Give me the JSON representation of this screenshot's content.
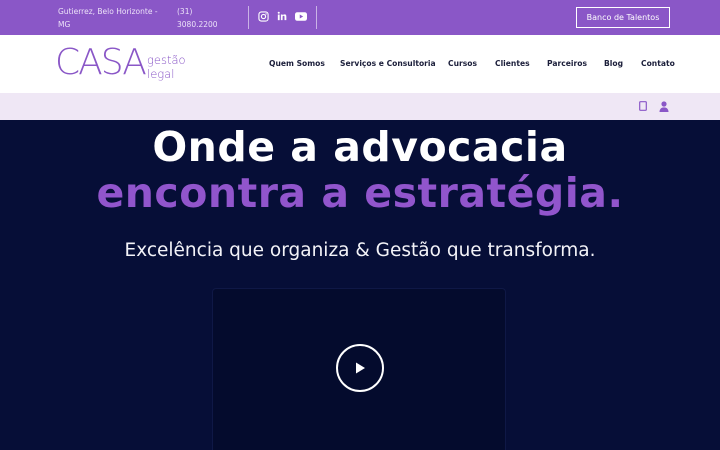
{
  "topbar": {
    "address": "Gutierrez, Belo Horizonte - MG",
    "phone": "(31) 3080.2200",
    "social": [
      "instagram-icon",
      "linkedin-icon",
      "youtube-icon"
    ],
    "talent_button": "Banco de Talentos",
    "color": "#8a57c7"
  },
  "logo": {
    "wordmark": "CASA",
    "sub1": "gestão",
    "sub2": "legal"
  },
  "nav": {
    "items": [
      "Quem Somos",
      "Serviços e Consultoria",
      "Cursos",
      "Clientes",
      "Parceiros",
      "Blog",
      "Contato"
    ]
  },
  "subbar": {
    "icons": [
      "document-icon",
      "user-icon"
    ]
  },
  "hero": {
    "line1": "Onde a advocacia",
    "line2": "encontra a estratégia.",
    "tagline": "Excelência que organiza & Gestão que transforma.",
    "background": "#060e37",
    "accent": "#9155cc",
    "video_icon": "play-icon"
  }
}
